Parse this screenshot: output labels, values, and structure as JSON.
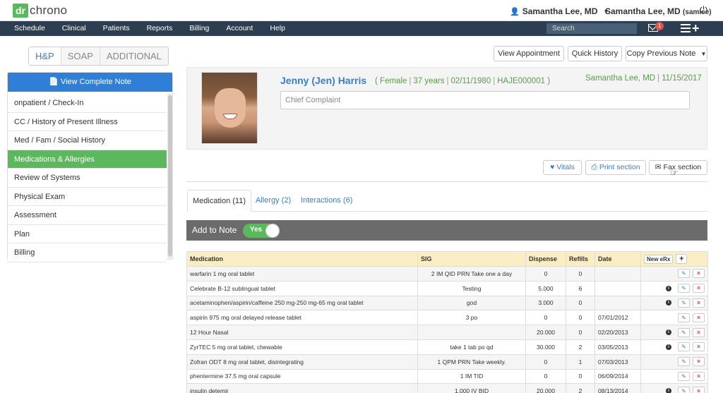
{
  "brand": {
    "logo_mark": "dr",
    "logo_text": "chrono"
  },
  "header": {
    "user_name": "Samantha Lee, MD",
    "account_name": "Samantha Lee, MD",
    "account_username": "(samlee)"
  },
  "nav": {
    "items": [
      "Schedule",
      "Clinical",
      "Patients",
      "Reports",
      "Billing",
      "Account",
      "Help"
    ],
    "search_placeholder": "Search",
    "mail_count": "1"
  },
  "note_tabs": [
    "H&P",
    "SOAP",
    "ADDITIONAL"
  ],
  "sidebar": {
    "view_note_label": "View Complete Note",
    "items": [
      "onpatient / Check-In",
      "CC / History of Present Illness",
      "Med / Fam / Social History",
      "Medications & Allergies",
      "Review of Systems",
      "Physical Exam",
      "Assessment",
      "Plan",
      "Billing"
    ],
    "active_index": 3
  },
  "top_actions": {
    "view_appointment": "View Appointment",
    "quick_history": "Quick History",
    "copy_previous_note": "Copy Previous Note"
  },
  "patient": {
    "name": "Jenny (Jen) Harris",
    "gender": "Female",
    "age": "37 years",
    "dob": "02/11/1980",
    "chart_id": "HAJE000001",
    "provider": "Samantha Lee, MD",
    "visit_date": "11/15/2017",
    "chief_complaint_placeholder": "Chief Complaint"
  },
  "section_actions": {
    "vitals": "Vitals",
    "print_section": "Print section",
    "fax_section": "Fax section"
  },
  "med_tabs": [
    "Medication (11)",
    "Allergy (2)",
    "Interactions (6)"
  ],
  "add_to_note": {
    "label": "Add to Note",
    "toggle": "Yes"
  },
  "table": {
    "headers": {
      "medication": "Medication",
      "sig": "SIG",
      "dispense": "Dispense",
      "refills": "Refills",
      "date": "Date",
      "new_erx": "New eRx",
      "add": "+"
    },
    "rows": [
      {
        "medication": "warfarin 1 mg oral tablet",
        "sig": "2 IM QID PRN Take one a day",
        "dispense": "0",
        "refills": "0",
        "date": "",
        "info": false
      },
      {
        "medication": "Celebrate B-12 sublingual tablet",
        "sig": "Testing",
        "dispense": "5.000",
        "refills": "6",
        "date": "",
        "info": true
      },
      {
        "medication": "acetaminophen/aspirin/caffeine 250 mg-250 mg-65 mg oral tablet",
        "sig": "god",
        "dispense": "3.000",
        "refills": "0",
        "date": "",
        "info": true
      },
      {
        "medication": "aspirin 975 mg oral delayed release tablet",
        "sig": "3 po",
        "dispense": "0",
        "refills": "0",
        "date": "07/01/2012",
        "info": false
      },
      {
        "medication": "12 Hour Nasal",
        "sig": "",
        "dispense": "20.000",
        "refills": "0",
        "date": "02/20/2013",
        "info": true
      },
      {
        "medication": "ZyrTEC 5 mg oral tablet, chewable",
        "sig": "take 1 tab po qd",
        "dispense": "30.000",
        "refills": "2",
        "date": "03/05/2013",
        "info": true
      },
      {
        "medication": "Zofran ODT 8 mg oral tablet, disintegrating",
        "sig": "1 QPM PRN Take weekly.",
        "dispense": "0",
        "refills": "1",
        "date": "07/03/2013",
        "info": false
      },
      {
        "medication": "phentermine 37.5 mg oral capsule",
        "sig": "1 IM TID",
        "dispense": "0",
        "refills": "0",
        "date": "06/09/2014",
        "info": false
      },
      {
        "medication": "insulin detemir",
        "sig": "1.000 IV BID",
        "dispense": "20.000",
        "refills": "2",
        "date": "08/13/2014",
        "info": true
      }
    ]
  },
  "icons": {
    "user": "person-icon",
    "power": "power-icon",
    "mail": "mail-icon",
    "menu": "hamburger-icon",
    "add": "plus-icon",
    "note": "document-icon",
    "heart": "heart-icon",
    "print": "printer-icon",
    "fax": "fax-icon",
    "info": "info-icon",
    "edit": "edit-icon",
    "delete": "delete-icon"
  },
  "colors": {
    "nav_bg": "#2c3e50",
    "primary": "#2f7fd6",
    "success": "#5cb85c",
    "danger": "#d9534f",
    "table_header": "#fbeec4"
  }
}
